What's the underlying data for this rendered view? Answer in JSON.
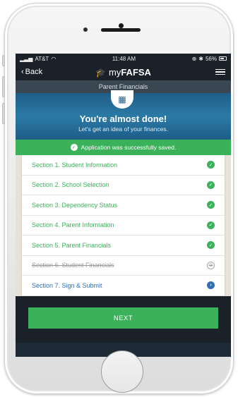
{
  "status_bar": {
    "carrier": "AT&T",
    "time": "11:48 AM",
    "battery": "56%"
  },
  "nav": {
    "back_label": "Back",
    "brand_prefix": "my",
    "brand_bold": "FAFSA"
  },
  "section_title": "Parent Financials",
  "hero": {
    "title": "You're almost done!",
    "subtitle": "Let's get an idea of your finances."
  },
  "banner": {
    "text": "Application was successfully saved."
  },
  "sections": [
    {
      "label": "Section 1. Student Information",
      "status": "complete"
    },
    {
      "label": "Section 2. School Selection",
      "status": "complete"
    },
    {
      "label": "Section 3. Dependency Status",
      "status": "complete"
    },
    {
      "label": "Section 4. Parent Information",
      "status": "complete"
    },
    {
      "label": "Section 5. Parent Financials",
      "status": "complete"
    },
    {
      "label": "Section 6. Student Financials",
      "status": "skipped"
    },
    {
      "label": "Section 7. Sign & Submit",
      "status": "next"
    }
  ],
  "next_button": "NEXT",
  "colors": {
    "accent_green": "#3bb15a",
    "hero_blue": "#1e5d87",
    "link_blue": "#2f6fb5",
    "nav_dark": "#1b2129"
  }
}
